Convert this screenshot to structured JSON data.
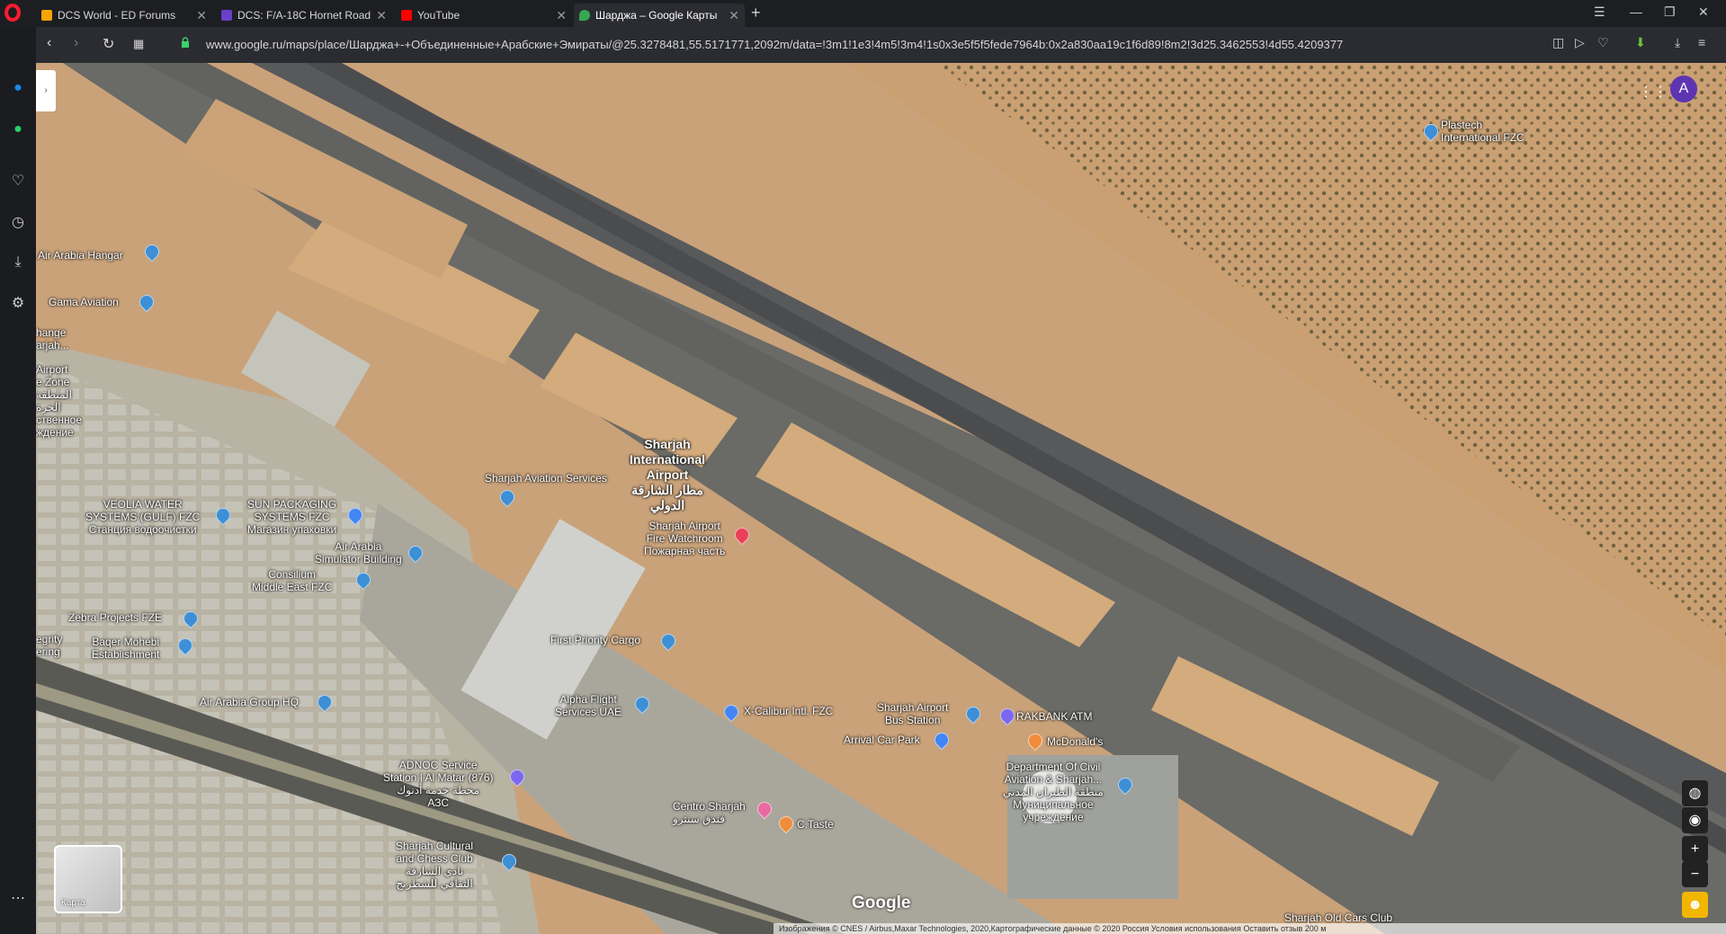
{
  "tabs": [
    {
      "title": "DCS World - ED Forums",
      "color": "#f7a400"
    },
    {
      "title": "DCS: F/A-18C Hornet Road",
      "color": "#6a3fc9"
    },
    {
      "title": "YouTube",
      "color": "#ff0000"
    },
    {
      "title": "Шарджа – Google Карты",
      "color": "#34a853"
    }
  ],
  "address": {
    "url": "www.google.ru/maps/place/Шарджа+-+Объединенные+Арабские+Эмираты/@25.3278481,55.5171771,2092m/data=!3m1!1e3!4m5!3m4!1s0x3e5f5f5fede7964b:0x2a830aa19c1f6d89!8m2!3d25.3462553!4d55.4209377"
  },
  "map": {
    "avatar_letter": "A",
    "layer_label": "Карта",
    "logo": "Google",
    "attribution": "Изображения © CNES / Airbus,Maxar Technologies, 2020,Картографические данные © 2020   Россия   Условия использования   Оставить отзыв   200 м",
    "pois": [
      {
        "label": "Plastech\nInternational FZC",
        "color": "#3d8fd6"
      },
      {
        "label": "Air Arabia Hangar",
        "color": "#3d8fd6"
      },
      {
        "label": "Gama Aviation",
        "color": "#3d8fd6"
      },
      {
        "label": "Sharjah\nInternational\nAirport\nمطار الشارقة\nالدولي",
        "color": "#3d8fd6"
      },
      {
        "label": "Sharjah Aviation Services",
        "color": "#3d8fd6"
      },
      {
        "label": "VEOLIA WATER\nSYSTEMS (GULF) FZC\nСтанция водоочистки",
        "color": "#3d8fd6"
      },
      {
        "label": "SUN PACKAGING\nSYSTEMS FZC\nМагазин упаковки",
        "color": "#4285f4"
      },
      {
        "label": "Sharjah Airport\nFire Watchroom\nПожарная часть",
        "color": "#e94057"
      },
      {
        "label": "Air Arabia\nSimulator Building",
        "color": "#3d8fd6"
      },
      {
        "label": "Consilium\nMiddle East FZC",
        "color": "#3d8fd6"
      },
      {
        "label": "Zebra Projects FZE",
        "color": "#3d8fd6"
      },
      {
        "label": "Baqer Mohebi\nEstablishment",
        "color": "#3d8fd6"
      },
      {
        "label": "First Priority Cargo",
        "color": "#3d8fd6"
      },
      {
        "label": "Air Arabia Group HQ",
        "color": "#3d8fd6"
      },
      {
        "label": "Alpha Flight\nServices UAE",
        "color": "#3d8fd6"
      },
      {
        "label": "X-Calibur Intl. FZC",
        "color": "#4285f4"
      },
      {
        "label": "Sharjah Airport\nBus Station",
        "color": "#3d8fd6"
      },
      {
        "label": "RAKBANK ATM",
        "color": "#7b68ee"
      },
      {
        "label": "Arrival Car Park",
        "color": "#4285f4"
      },
      {
        "label": "McDonald's",
        "color": "#f08c3c"
      },
      {
        "label": "ADNOC Service\nStation | Al Matar (876)\nمحطة خدمة أدنوك\nАЗС",
        "color": "#7b68ee"
      },
      {
        "label": "Department Of Civil\nAviation & Sharjah...\nمنطقة الطيران المدني\nМуниципальное\nучреждение",
        "color": "#3d8fd6"
      },
      {
        "label": "Centro Sharjah\nفندق سنترو",
        "color": "#e86aa1"
      },
      {
        "label": "C.Taste",
        "color": "#f08c3c"
      },
      {
        "label": "Sharjah Cultural\nand Chess Club\nنادي الشارقة\nالثقافي للشطرنج",
        "color": "#3d8fd6"
      },
      {
        "label": "Sharjah Old Cars Club",
        "color": "#3d8fd6"
      },
      {
        "label": "hange\narjah...",
        "color": "#3d8fd6"
      },
      {
        "label": "Airport\ne Zone\nالمنطقة\nالحرة\nственное\nждение",
        "color": "#3d8fd6"
      },
      {
        "label": "egrity\nering",
        "color": "#3d8fd6"
      }
    ]
  }
}
